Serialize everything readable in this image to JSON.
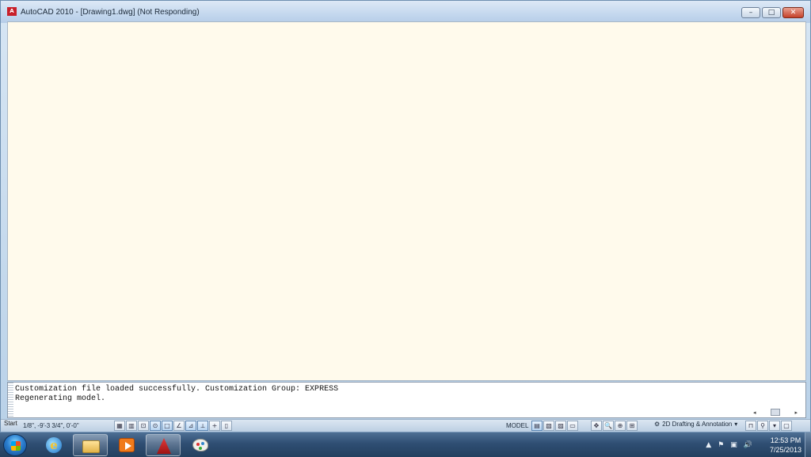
{
  "window": {
    "logo_text": "A",
    "title": "AutoCAD 2010 - [Drawing1.dwg] (Not Responding)",
    "minimize_glyph": "–",
    "restore_glyph": "□",
    "close_glyph": "✕"
  },
  "command_window": {
    "lines": [
      "Customization file loaded successfully. Customization Group: EXPRESS",
      "Regenerating model."
    ],
    "input_value": "",
    "scroll_left": "◂",
    "scroll_right": "▸"
  },
  "status_bar": {
    "start_label": "Start",
    "coordinates": "1/8\", -9'-3 3/4\", 0'-0\"",
    "mode_buttons": [
      "▦",
      "▥",
      "⊡",
      "⊙",
      "□",
      "∠",
      "⊿",
      "⟂",
      "+",
      "▯"
    ],
    "model_label": "MODEL",
    "layout_buttons": [
      "▤",
      "▧",
      "▨",
      "▭"
    ],
    "nav_buttons": [
      "✥",
      "🔍",
      "⊕",
      "⊞"
    ],
    "workspace_icon": "⚙",
    "workspace_label": "2D Drafting & Annotation",
    "workspace_arrow": "▾",
    "tray_buttons": [
      "⊓",
      "⚲",
      "▾",
      "▢"
    ]
  },
  "taskbar": {
    "ie_glyph": "e",
    "tray_arrow": "▲",
    "flag_glyph": "⚑",
    "network_glyph": "▣",
    "volume_glyph": "🔊",
    "time": "12:53 PM",
    "date": "7/25/2013"
  }
}
